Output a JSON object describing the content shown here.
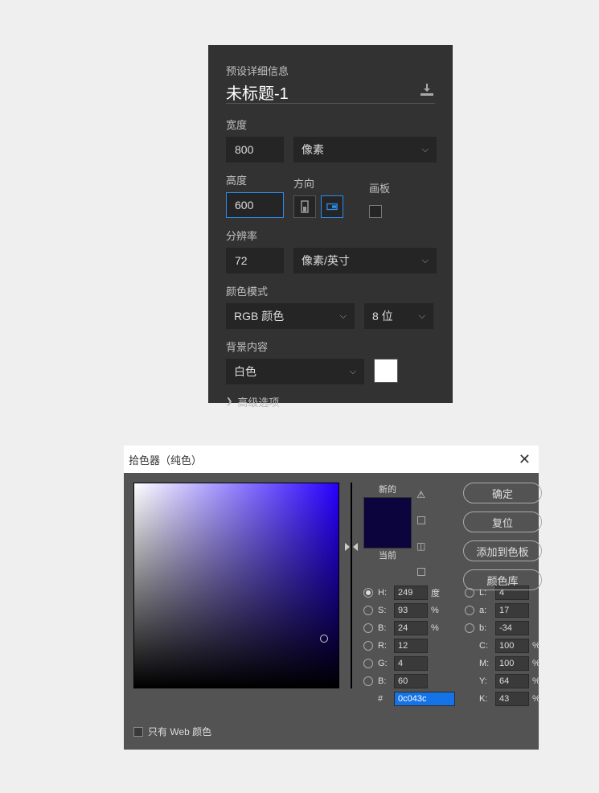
{
  "panel1": {
    "preset_label": "预设详细信息",
    "title": "未标题-1",
    "width_label": "宽度",
    "width_value": "800",
    "width_unit": "像素",
    "height_label": "高度",
    "height_value": "600",
    "orientation_label": "方向",
    "artboard_label": "画板",
    "resolution_label": "分辨率",
    "resolution_value": "72",
    "resolution_unit": "像素/英寸",
    "color_mode_label": "颜色模式",
    "color_mode_value": "RGB 颜色",
    "bit_depth_value": "8 位",
    "background_label": "背景内容",
    "background_value": "白色",
    "advanced_label": "高级选项"
  },
  "picker": {
    "title": "拾色器（纯色）",
    "new_label": "新的",
    "current_label": "当前",
    "ok_label": "确定",
    "cancel_label": "复位",
    "add_swatch_label": "添加到色板",
    "libraries_label": "颜色库",
    "H_label": "H:",
    "H_val": "249",
    "H_unit": "度",
    "S_label": "S:",
    "S_val": "93",
    "S_unit": "%",
    "Bv_label": "B:",
    "Bv_val": "24",
    "Bv_unit": "%",
    "R_label": "R:",
    "R_val": "12",
    "G_label": "G:",
    "G_val": "4",
    "Bb_label": "B:",
    "Bb_val": "60",
    "L_label": "L:",
    "L_val": "4",
    "a_label": "a:",
    "a_val": "17",
    "b_label": "b:",
    "b_val": "-34",
    "C_label": "C:",
    "C_val": "100",
    "C_unit": "%",
    "M_label": "M:",
    "M_val": "100",
    "M_unit": "%",
    "Y_label": "Y:",
    "Y_val": "64",
    "Y_unit": "%",
    "K_label": "K:",
    "K_val": "43",
    "K_unit": "%",
    "hex_prefix": "#",
    "hex_val": "0c043c",
    "web_only_label": "只有 Web 颜色"
  }
}
